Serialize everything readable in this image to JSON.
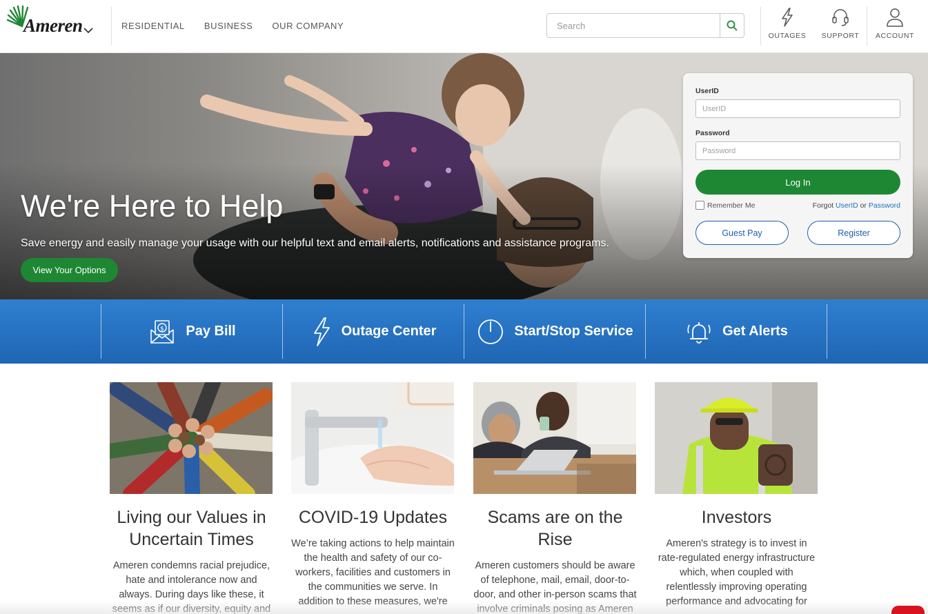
{
  "brand": {
    "name": "Ameren",
    "accent_green": "#1e8733",
    "accent_blue": "#1f66b4",
    "link_blue": "#1f6fbf"
  },
  "nav": {
    "items": [
      "RESIDENTIAL",
      "BUSINESS",
      "OUR COMPANY"
    ]
  },
  "search": {
    "placeholder": "Search",
    "icon": "search-icon"
  },
  "utility": [
    {
      "label": "OUTAGES",
      "icon": "lightning-icon"
    },
    {
      "label": "SUPPORT",
      "icon": "headset-icon"
    },
    {
      "label": "ACCOUNT",
      "icon": "user-icon"
    }
  ],
  "hero": {
    "title": "We're Here to Help",
    "subtitle": "Save energy and easily manage your usage with our helpful text and email alerts, notifications and assistance programs.",
    "button": "View Your Options"
  },
  "login": {
    "userid_label": "UserID",
    "userid_placeholder": "UserID",
    "password_label": "Password",
    "password_placeholder": "Password",
    "login_button": "Log In",
    "remember_me": "Remember Me",
    "forgot_prefix": "Forgot",
    "forgot_userid": "UserID",
    "forgot_or": "or",
    "forgot_password": "Password",
    "guest_pay": "Guest Pay",
    "register": "Register"
  },
  "quick_links": [
    {
      "label": "Pay Bill",
      "icon": "bill-envelope-icon"
    },
    {
      "label": "Outage Center",
      "icon": "lightning-icon"
    },
    {
      "label": "Start/Stop Service",
      "icon": "power-icon"
    },
    {
      "label": "Get Alerts",
      "icon": "alarm-bell-icon"
    }
  ],
  "cards": [
    {
      "title": "Living our Values in Uncertain Times",
      "text": "Ameren condemns racial prejudice, hate and intolerance now and always. During days like these, it seems as if our diversity, equity and"
    },
    {
      "title": "COVID-19 Updates",
      "text": "We’re taking actions to help maintain the health and safety of our co-workers, facilities and customers in the communities we serve. In addition to these measures, we're"
    },
    {
      "title": "Scams are on the Rise",
      "text": "Ameren customers should be aware of telephone, mail, email, door-to-door, and other in-person scams that involve criminals posing as Ameren"
    },
    {
      "title": "Investors",
      "text": "Ameren's strategy is to invest in rate-regulated energy infrastructure which, when coupled with relentlessly improving operating performance and advocating for"
    }
  ]
}
